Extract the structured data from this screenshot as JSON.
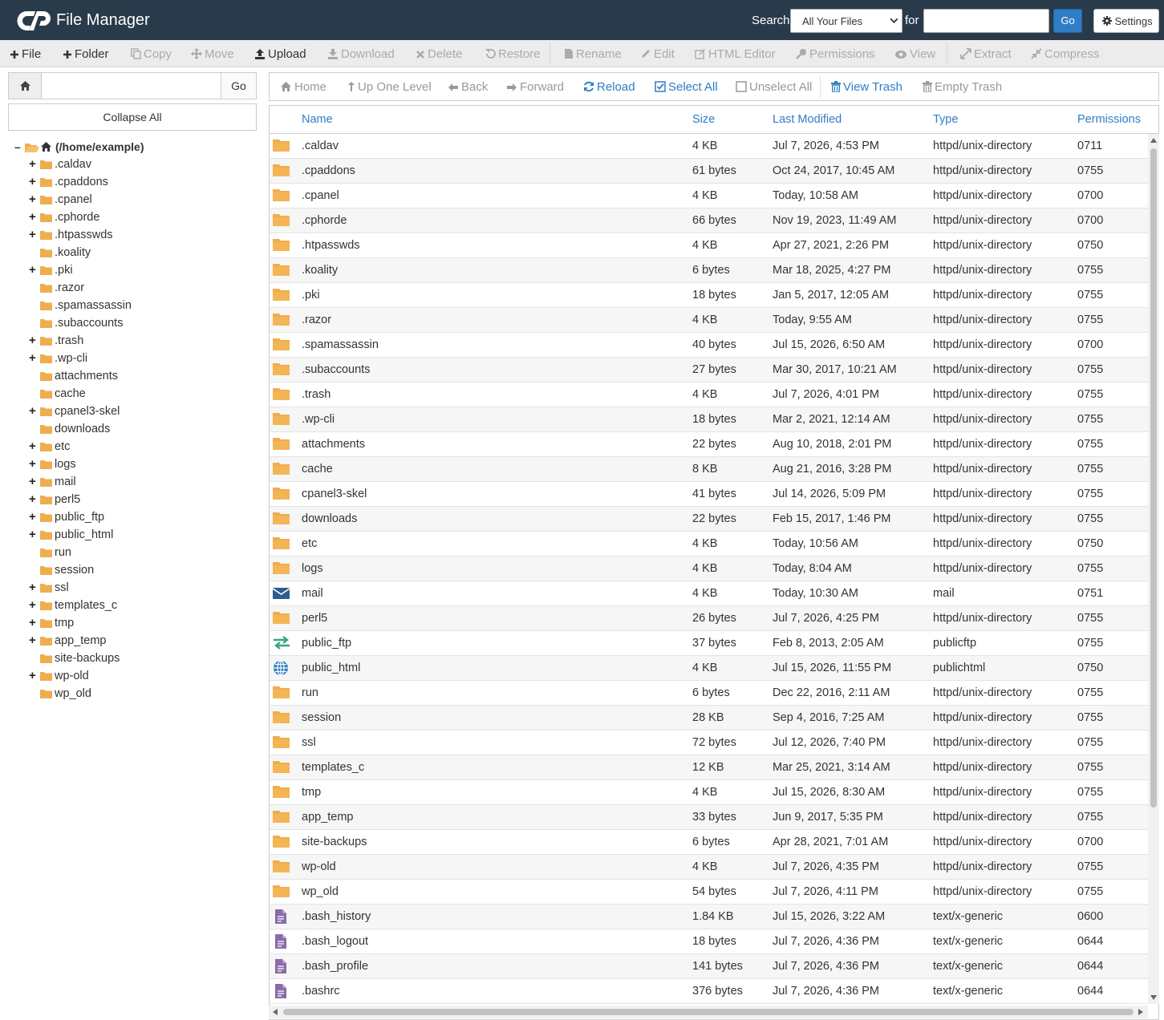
{
  "app": {
    "title": "File Manager"
  },
  "search": {
    "label": "Search",
    "scope": "All Your Files",
    "for_label": "for",
    "go": "Go",
    "settings": "Settings"
  },
  "toolbar": {
    "file": "File",
    "folder": "Folder",
    "copy": "Copy",
    "move": "Move",
    "upload": "Upload",
    "download": "Download",
    "delete": "Delete",
    "restore": "Restore",
    "rename": "Rename",
    "edit": "Edit",
    "html_editor": "HTML Editor",
    "permissions": "Permissions",
    "view": "View",
    "extract": "Extract",
    "compress": "Compress"
  },
  "left": {
    "go": "Go",
    "collapse": "Collapse All",
    "root": "(/home/example)",
    "tree": [
      {
        "name": ".caldav",
        "expandable": true
      },
      {
        "name": ".cpaddons",
        "expandable": true
      },
      {
        "name": ".cpanel",
        "expandable": true
      },
      {
        "name": ".cphorde",
        "expandable": true
      },
      {
        "name": ".htpasswds",
        "expandable": true
      },
      {
        "name": ".koality",
        "expandable": false
      },
      {
        "name": ".pki",
        "expandable": true
      },
      {
        "name": ".razor",
        "expandable": false
      },
      {
        "name": ".spamassassin",
        "expandable": false
      },
      {
        "name": ".subaccounts",
        "expandable": false
      },
      {
        "name": ".trash",
        "expandable": true
      },
      {
        "name": ".wp-cli",
        "expandable": true
      },
      {
        "name": "attachments",
        "expandable": false
      },
      {
        "name": "cache",
        "expandable": false
      },
      {
        "name": "cpanel3-skel",
        "expandable": true
      },
      {
        "name": "downloads",
        "expandable": false
      },
      {
        "name": "etc",
        "expandable": true
      },
      {
        "name": "logs",
        "expandable": true
      },
      {
        "name": "mail",
        "expandable": true
      },
      {
        "name": "perl5",
        "expandable": true
      },
      {
        "name": "public_ftp",
        "expandable": true
      },
      {
        "name": "public_html",
        "expandable": true
      },
      {
        "name": "run",
        "expandable": false
      },
      {
        "name": "session",
        "expandable": false
      },
      {
        "name": "ssl",
        "expandable": true
      },
      {
        "name": "templates_c",
        "expandable": true
      },
      {
        "name": "tmp",
        "expandable": true
      },
      {
        "name": "app_temp",
        "expandable": true
      },
      {
        "name": "site-backups",
        "expandable": false
      },
      {
        "name": "wp-old",
        "expandable": true
      },
      {
        "name": "wp_old",
        "expandable": false
      }
    ]
  },
  "nav": {
    "home": "Home",
    "up": "Up One Level",
    "back": "Back",
    "forward": "Forward",
    "reload": "Reload",
    "select_all": "Select All",
    "unselect_all": "Unselect All",
    "view_trash": "View Trash",
    "empty_trash": "Empty Trash"
  },
  "table": {
    "columns": [
      "Name",
      "Size",
      "Last Modified",
      "Type",
      "Permissions"
    ],
    "rows": [
      {
        "icon": "folder",
        "name": ".caldav",
        "size": "4 KB",
        "modified": "Jul 7, 2026, 4:53 PM",
        "type": "httpd/unix-directory",
        "perms": "0711"
      },
      {
        "icon": "folder",
        "name": ".cpaddons",
        "size": "61 bytes",
        "modified": "Oct 24, 2017, 10:45 AM",
        "type": "httpd/unix-directory",
        "perms": "0755"
      },
      {
        "icon": "folder",
        "name": ".cpanel",
        "size": "4 KB",
        "modified": "Today, 10:58 AM",
        "type": "httpd/unix-directory",
        "perms": "0700"
      },
      {
        "icon": "folder",
        "name": ".cphorde",
        "size": "66 bytes",
        "modified": "Nov 19, 2023, 11:49 AM",
        "type": "httpd/unix-directory",
        "perms": "0700"
      },
      {
        "icon": "folder",
        "name": ".htpasswds",
        "size": "4 KB",
        "modified": "Apr 27, 2021, 2:26 PM",
        "type": "httpd/unix-directory",
        "perms": "0750"
      },
      {
        "icon": "folder",
        "name": ".koality",
        "size": "6 bytes",
        "modified": "Mar 18, 2025, 4:27 PM",
        "type": "httpd/unix-directory",
        "perms": "0755"
      },
      {
        "icon": "folder",
        "name": ".pki",
        "size": "18 bytes",
        "modified": "Jan 5, 2017, 12:05 AM",
        "type": "httpd/unix-directory",
        "perms": "0755"
      },
      {
        "icon": "folder",
        "name": ".razor",
        "size": "4 KB",
        "modified": "Today, 9:55 AM",
        "type": "httpd/unix-directory",
        "perms": "0755"
      },
      {
        "icon": "folder",
        "name": ".spamassassin",
        "size": "40 bytes",
        "modified": "Jul 15, 2026, 6:50 AM",
        "type": "httpd/unix-directory",
        "perms": "0700"
      },
      {
        "icon": "folder",
        "name": ".subaccounts",
        "size": "27 bytes",
        "modified": "Mar 30, 2017, 10:21 AM",
        "type": "httpd/unix-directory",
        "perms": "0755"
      },
      {
        "icon": "folder",
        "name": ".trash",
        "size": "4 KB",
        "modified": "Jul 7, 2026, 4:01 PM",
        "type": "httpd/unix-directory",
        "perms": "0755"
      },
      {
        "icon": "folder",
        "name": ".wp-cli",
        "size": "18 bytes",
        "modified": "Mar 2, 2021, 12:14 AM",
        "type": "httpd/unix-directory",
        "perms": "0755"
      },
      {
        "icon": "folder",
        "name": "attachments",
        "size": "22 bytes",
        "modified": "Aug 10, 2018, 2:01 PM",
        "type": "httpd/unix-directory",
        "perms": "0755"
      },
      {
        "icon": "folder",
        "name": "cache",
        "size": "8 KB",
        "modified": "Aug 21, 2016, 3:28 PM",
        "type": "httpd/unix-directory",
        "perms": "0755"
      },
      {
        "icon": "folder",
        "name": "cpanel3-skel",
        "size": "41 bytes",
        "modified": "Jul 14, 2026, 5:09 PM",
        "type": "httpd/unix-directory",
        "perms": "0755"
      },
      {
        "icon": "folder",
        "name": "downloads",
        "size": "22 bytes",
        "modified": "Feb 15, 2017, 1:46 PM",
        "type": "httpd/unix-directory",
        "perms": "0755"
      },
      {
        "icon": "folder",
        "name": "etc",
        "size": "4 KB",
        "modified": "Today, 10:56 AM",
        "type": "httpd/unix-directory",
        "perms": "0750"
      },
      {
        "icon": "folder",
        "name": "logs",
        "size": "4 KB",
        "modified": "Today, 8:04 AM",
        "type": "httpd/unix-directory",
        "perms": "0755"
      },
      {
        "icon": "mail",
        "name": "mail",
        "size": "4 KB",
        "modified": "Today, 10:30 AM",
        "type": "mail",
        "perms": "0751"
      },
      {
        "icon": "folder",
        "name": "perl5",
        "size": "26 bytes",
        "modified": "Jul 7, 2026, 4:25 PM",
        "type": "httpd/unix-directory",
        "perms": "0755"
      },
      {
        "icon": "ftp",
        "name": "public_ftp",
        "size": "37 bytes",
        "modified": "Feb 8, 2013, 2:05 AM",
        "type": "publicftp",
        "perms": "0755"
      },
      {
        "icon": "globe",
        "name": "public_html",
        "size": "4 KB",
        "modified": "Jul 15, 2026, 11:55 PM",
        "type": "publichtml",
        "perms": "0750"
      },
      {
        "icon": "folder",
        "name": "run",
        "size": "6 bytes",
        "modified": "Dec 22, 2016, 2:11 AM",
        "type": "httpd/unix-directory",
        "perms": "0755"
      },
      {
        "icon": "folder",
        "name": "session",
        "size": "28 KB",
        "modified": "Sep 4, 2016, 7:25 AM",
        "type": "httpd/unix-directory",
        "perms": "0755"
      },
      {
        "icon": "folder",
        "name": "ssl",
        "size": "72 bytes",
        "modified": "Jul 12, 2026, 7:40 PM",
        "type": "httpd/unix-directory",
        "perms": "0755"
      },
      {
        "icon": "folder",
        "name": "templates_c",
        "size": "12 KB",
        "modified": "Mar 25, 2021, 3:14 AM",
        "type": "httpd/unix-directory",
        "perms": "0755"
      },
      {
        "icon": "folder",
        "name": "tmp",
        "size": "4 KB",
        "modified": "Jul 15, 2026, 8:30 AM",
        "type": "httpd/unix-directory",
        "perms": "0755"
      },
      {
        "icon": "folder",
        "name": "app_temp",
        "size": "33 bytes",
        "modified": "Jun 9, 2017, 5:35 PM",
        "type": "httpd/unix-directory",
        "perms": "0755"
      },
      {
        "icon": "folder",
        "name": "site-backups",
        "size": "6 bytes",
        "modified": "Apr 28, 2021, 7:01 AM",
        "type": "httpd/unix-directory",
        "perms": "0700"
      },
      {
        "icon": "folder",
        "name": "wp-old",
        "size": "4 KB",
        "modified": "Jul 7, 2026, 4:35 PM",
        "type": "httpd/unix-directory",
        "perms": "0755"
      },
      {
        "icon": "folder",
        "name": "wp_old",
        "size": "54 bytes",
        "modified": "Jul 7, 2026, 4:11 PM",
        "type": "httpd/unix-directory",
        "perms": "0755"
      },
      {
        "icon": "text",
        "name": ".bash_history",
        "size": "1.84 KB",
        "modified": "Jul 15, 2026, 3:22 AM",
        "type": "text/x-generic",
        "perms": "0600"
      },
      {
        "icon": "text",
        "name": ".bash_logout",
        "size": "18 bytes",
        "modified": "Jul 7, 2026, 4:36 PM",
        "type": "text/x-generic",
        "perms": "0644"
      },
      {
        "icon": "text",
        "name": ".bash_profile",
        "size": "141 bytes",
        "modified": "Jul 7, 2026, 4:36 PM",
        "type": "text/x-generic",
        "perms": "0644"
      },
      {
        "icon": "text",
        "name": ".bashrc",
        "size": "376 bytes",
        "modified": "Jul 7, 2026, 4:36 PM",
        "type": "text/x-generic",
        "perms": "0644"
      }
    ]
  },
  "colors": {
    "header_bg": "#293a4a",
    "accent": "#2f7ec4",
    "folder": "#f0ad4e",
    "text_file": "#8a6aa8"
  }
}
